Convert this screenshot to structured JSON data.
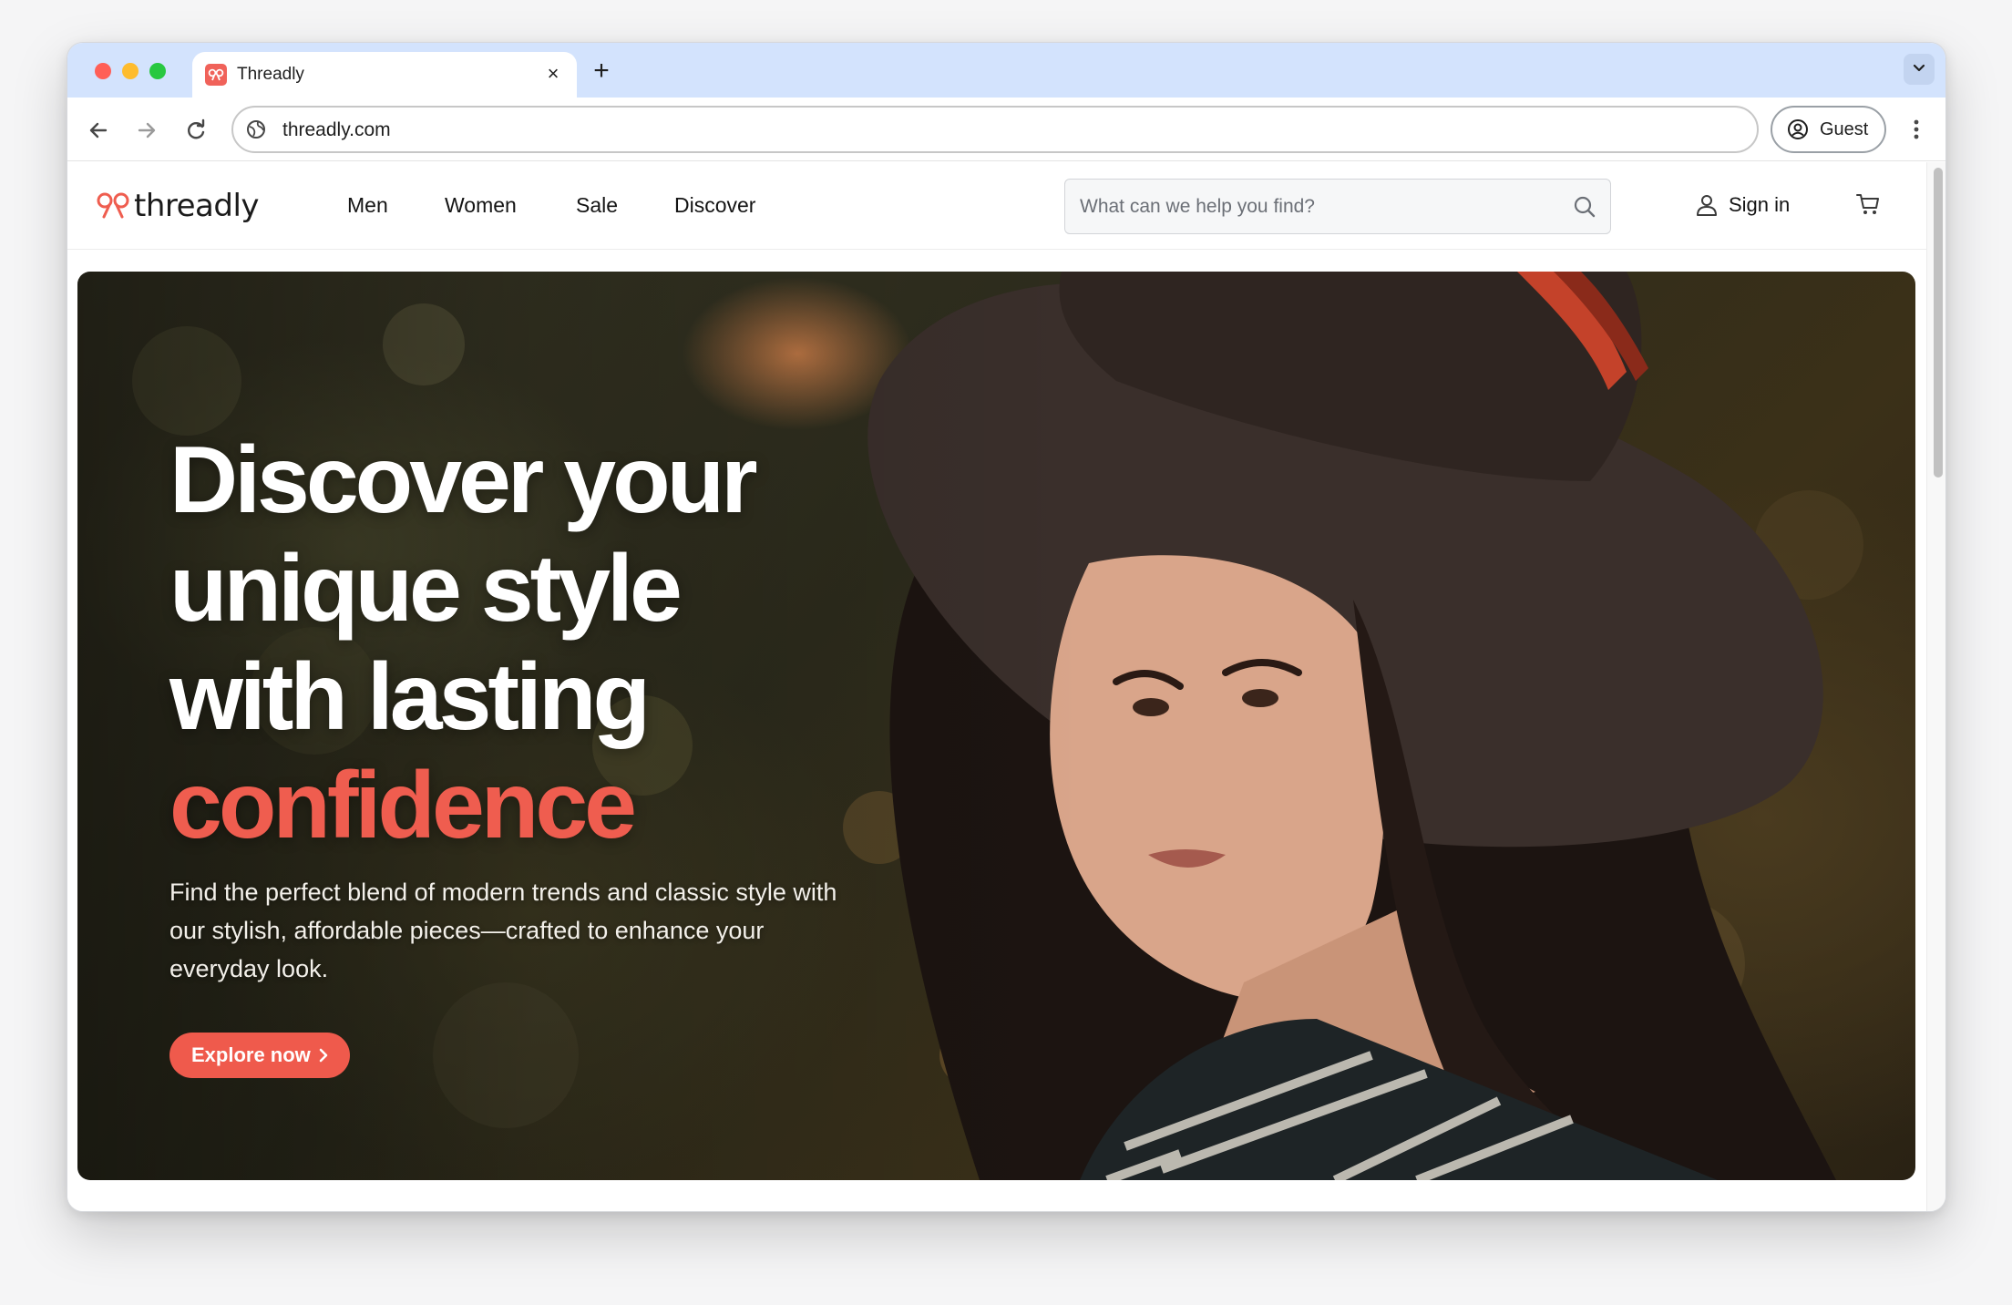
{
  "browser": {
    "tab_title": "Threadly",
    "tab_close": "×",
    "new_tab": "+",
    "url": "threadly.com",
    "profile_label": "Guest"
  },
  "site": {
    "logo_text": "threadly",
    "nav": [
      "Men",
      "Women",
      "Sale",
      "Discover"
    ],
    "search_placeholder": "What can we help you find?",
    "sign_in": "Sign in"
  },
  "hero": {
    "headline_lines": [
      "Discover your",
      "unique style",
      "with lasting"
    ],
    "headline_accent": "confidence",
    "subtext": "Find the perfect blend of modern trends and classic style with our stylish, affordable pieces—crafted to enhance your everyday look.",
    "cta_label": "Explore now"
  },
  "colors": {
    "brand": "#ef5d4f",
    "tabstrip": "#d3e3fd"
  },
  "icons": {
    "tab_favicon": "threadly-bow-icon",
    "search": "search-icon",
    "user": "user-icon",
    "cart": "cart-icon"
  }
}
